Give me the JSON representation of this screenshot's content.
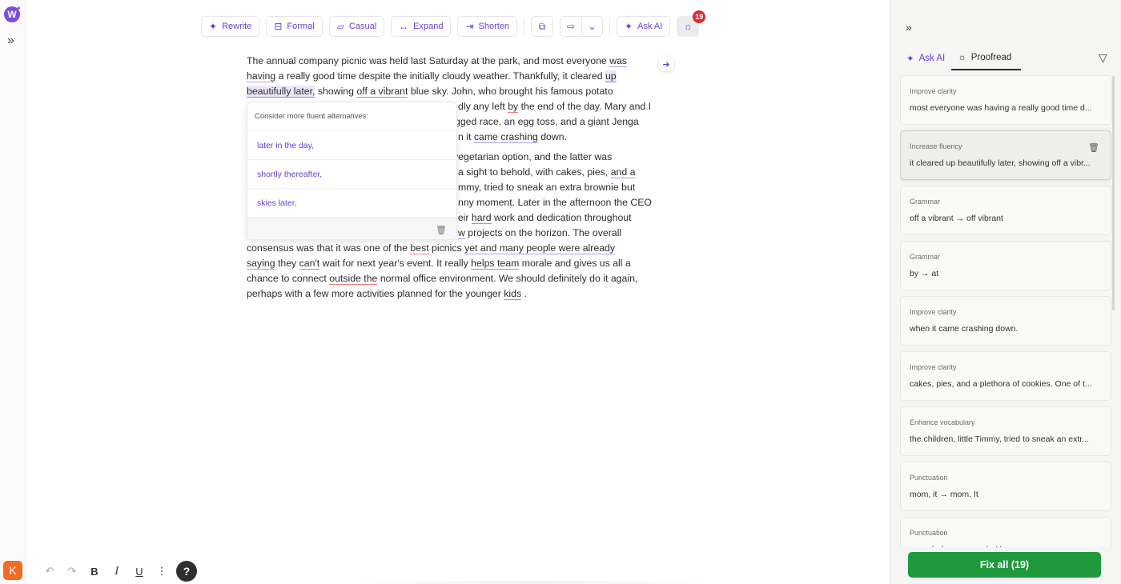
{
  "app": {
    "logo_letter": "W",
    "user_initial": "K"
  },
  "toolbar": {
    "rewrite": "Rewrite",
    "formal": "Formal",
    "casual": "Casual",
    "expand": "Expand",
    "shorten": "Shorten",
    "ask_ai": "Ask AI",
    "badge_count": "19"
  },
  "document": {
    "p1": {
      "s1a": "The annual company picnic was held last Saturday at the park, and most everyone ",
      "s1b": "was having",
      "s1c": " a really good time despite the initially cloudy weather. Thankfully, it cleared ",
      "s1d": "up beautifully later,",
      "s1e": " showing ",
      "s1f": "off a vibrant",
      "s1g": " blue sky. John, who brought his famous potato",
      "l4a": "dly any left ",
      "l4b": "by",
      "l4c": " the end of the day. Mary and I",
      "l5": "gged race, an egg toss, and a giant Jenga",
      "l6a": "n it ",
      "l6b": "came crashing",
      "l6c": " down."
    },
    "p2": {
      "l1": "vegetarian option, and the latter was",
      "l2a": "a sight to behold, with cakes, pies, ",
      "l2b": "and a",
      "l3": "mmy, tried to sneak an extra brownie but",
      "l4": "nny moment. Later in the afternoon the CEO",
      "l5a": "heir ",
      "l5b": "hard",
      "l5c": " work and dedication throughout",
      "l6a": "w",
      "l6b": " projects on the horizon. The overall",
      "l7a": "consensus was that it was one of the ",
      "l7b": "best",
      "l7c": " picnics ",
      "l7d": "yet and many people were already ",
      "l8a": "saying",
      "l8b": " they ",
      "l8c": "can't",
      "l8d": " wait for next year's event. It really ",
      "l8e": "helps team",
      "l8f": " morale and gives us all a",
      "l9a": "chance to connect ",
      "l9b": "outside the",
      "l9c": " normal office environment. We should definitely do it again,",
      "l10a": "perhaps with a few more activities planned for the younger ",
      "l10b": "kids",
      "l10c": " ."
    }
  },
  "popover": {
    "heading": "Consider more fluent alternatives:",
    "options": [
      "later in the day,",
      "shortly thereafter,",
      "skies later,"
    ]
  },
  "panel": {
    "tab_ask_ai": "Ask AI",
    "tab_proofread": "Proofread",
    "cards": [
      {
        "category": "Improve clarity",
        "pre": "most everyone ",
        "hl": "was having",
        "post": " a really good time d..."
      },
      {
        "category": "Increase fluency",
        "pre": "it cleared ",
        "hl": "up beautifully later,",
        "post": " showing off a vibr..."
      },
      {
        "category": "Grammar",
        "pre": "",
        "hl": "off a vibrant",
        "post": " → off vibrant"
      },
      {
        "category": "Grammar",
        "pre": "",
        "hl": "by",
        "post": " → at"
      },
      {
        "category": "Improve clarity",
        "pre": "when it ",
        "hl": "came crashing",
        "post": " down."
      },
      {
        "category": "Improve clarity",
        "pre": "cakes, pies, ",
        "hl": "and a plethora of cookies.",
        "post": " One of t..."
      },
      {
        "category": "Enhance vocabulary",
        "pre": "the children, ",
        "hl": "little",
        "post": " Timmy, tried to sneak an extr..."
      },
      {
        "category": "Punctuation",
        "pre": "",
        "hl": "mom, it",
        "post": " → mom. It"
      },
      {
        "category": "Punctuation",
        "pre": "",
        "hl": "speech, he",
        "post": " → speech. He"
      }
    ],
    "fix_all": "Fix all (19)"
  },
  "colors": {
    "accent": "#6a3fd1",
    "success": "#1e9a3c",
    "badge": "#e3262f",
    "avatar": "#f26b22"
  }
}
